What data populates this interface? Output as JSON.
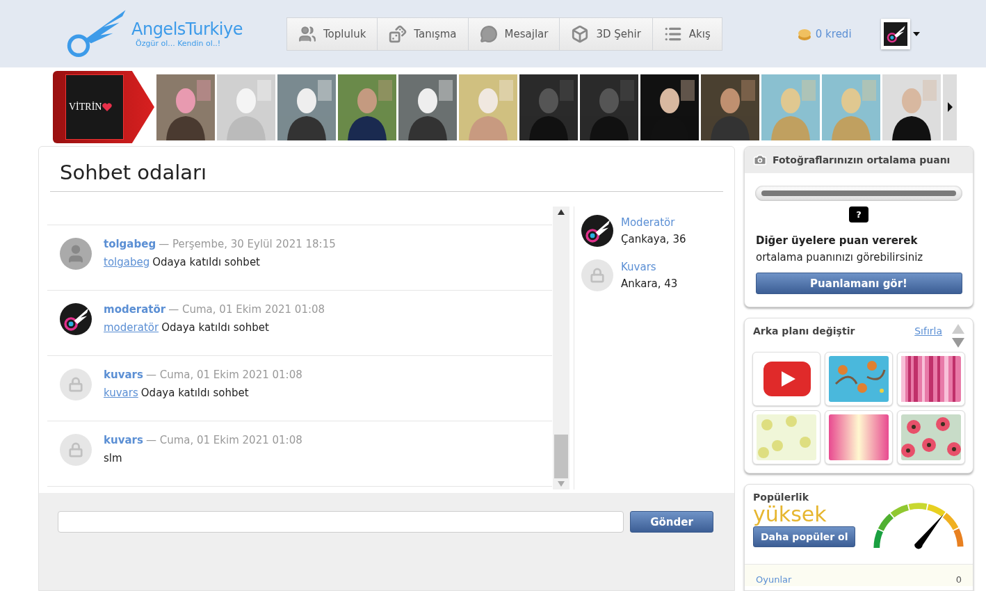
{
  "header": {
    "logo": {
      "title": "AngelsTurkiye",
      "tagline": "Özgür ol... Kendin ol..!"
    },
    "nav": [
      {
        "label": "Topluluk",
        "kind": "community"
      },
      {
        "label": "Tanışma",
        "kind": "dating"
      },
      {
        "label": "Mesajlar",
        "kind": "messages"
      },
      {
        "label": "3D Şehir",
        "kind": "city"
      },
      {
        "label": "Akış",
        "kind": "feed"
      }
    ],
    "credits": "0 kredi"
  },
  "showcase": {
    "badge": "VİTRİN"
  },
  "chat": {
    "title": "Sohbet odaları",
    "messages": [
      {
        "author": "tolgabeg",
        "date": "— Perşembe, 30 Eylül 2021 18:15",
        "avatar": {
          "kind": "default"
        },
        "link": "tolgabeg",
        "text": "Odaya katıldı sohbet"
      },
      {
        "author": "moderatör",
        "date": "— Cuma, 01 Ekim 2021 01:08",
        "avatar": {
          "kind": "logo"
        },
        "link": "moderatör",
        "text": "Odaya katıldı sohbet"
      },
      {
        "author": "kuvars",
        "date": "— Cuma, 01 Ekim 2021 01:08",
        "avatar": {
          "kind": "lock"
        },
        "link": "kuvars",
        "text": "Odaya katıldı sohbet"
      },
      {
        "author": "kuvars",
        "date": "— Cuma, 01 Ekim 2021 01:08",
        "avatar": {
          "kind": "lock"
        },
        "text": "slm"
      }
    ],
    "members": [
      {
        "name": "Moderatör",
        "place": "Çankaya, 36",
        "avatar": {
          "kind": "logo"
        }
      },
      {
        "name": "Kuvars",
        "place": "Ankara, 43",
        "avatar": {
          "kind": "lock"
        }
      }
    ],
    "send_button": "Gönder"
  },
  "rating": {
    "title": "Fotoğraflarınızın ortalama puanı",
    "marker": "?",
    "message": "**Diğer üyelere puan vererek** ortalama puanınızı görebilirsiniz",
    "button": "Puanlamanı gör!"
  },
  "background": {
    "title": "Arka planı değiştir",
    "reset": "Sıfırla",
    "swatches": [
      {
        "kind": "video"
      },
      {
        "kind": "monkeys"
      },
      {
        "kind": "stripes"
      },
      {
        "kind": "floral"
      },
      {
        "kind": "gradient"
      },
      {
        "kind": "flowers"
      }
    ]
  },
  "popularity": {
    "title": "Popülerlik",
    "value": "yüksek",
    "button": "Daha popüler ol",
    "stats": [
      {
        "label": "Oyunlar",
        "value": "0"
      }
    ]
  }
}
